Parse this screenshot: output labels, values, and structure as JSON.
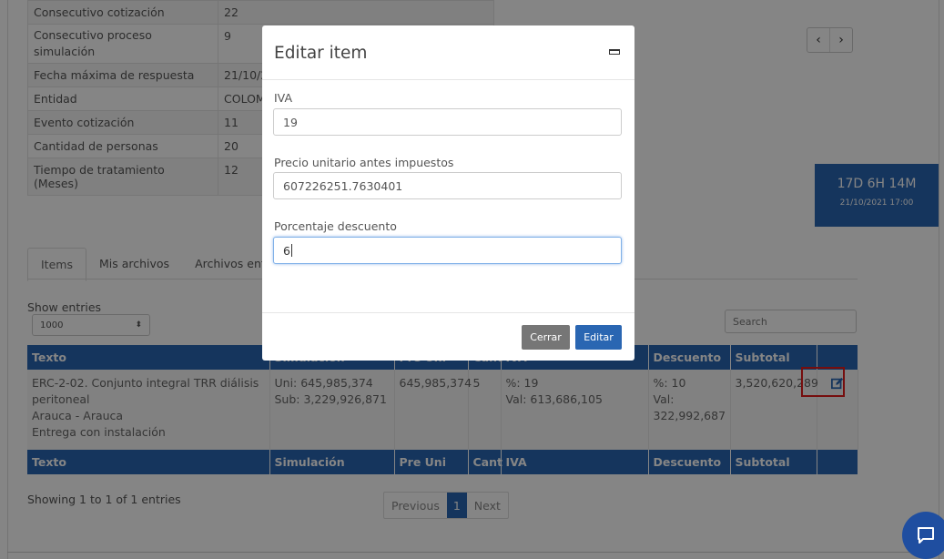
{
  "info_rows": [
    {
      "label": "Consecutivo cotización",
      "value": "22"
    },
    {
      "label": "Consecutivo proceso simulación",
      "value": "9"
    },
    {
      "label": "Fecha máxima de respuesta",
      "value": "21/10/2"
    },
    {
      "label": "Entidad",
      "value": "COLOM"
    },
    {
      "label": "Evento cotización",
      "value": "11"
    },
    {
      "label": "Cantidad de personas",
      "value": "20"
    },
    {
      "label": "Tiempo de tratamiento (Meses)",
      "value": "12"
    }
  ],
  "pager_arrows": {
    "prev": "‹",
    "next": "›"
  },
  "timer": {
    "remaining": "17D 6H 14M",
    "deadline": "21/10/2021 17:00",
    "color": "#2a66b2"
  },
  "tabs": [
    {
      "label": "Items"
    },
    {
      "label": "Mis archivos"
    },
    {
      "label": "Archivos ent"
    }
  ],
  "table_controls": {
    "show_entries": "Show entries",
    "entries_value": "1000",
    "search_placeholder": "Search"
  },
  "table": {
    "headers": [
      "Texto",
      "Simulación",
      "Pre Uni",
      "Cant",
      "IVA",
      "Descuento",
      "Subtotal",
      ""
    ],
    "row": {
      "texto": [
        "ERC-2-02. Conjunto integral TRR diálisis peritoneal",
        "Arauca - Arauca",
        "Entrega con instalación"
      ],
      "simulacion": [
        "Uni: 645,985,374",
        "Sub: 3,229,926,871"
      ],
      "pre_uni": "645,985,374",
      "cant": "5",
      "iva": [
        "%: 19",
        "Val: 613,686,105"
      ],
      "descuento": [
        "%: 10",
        "Val:",
        "322,992,687"
      ],
      "subtotal": "3,520,620,289"
    }
  },
  "footer": {
    "showing": "Showing 1 to 1 of 1 entries",
    "previous": "Previous",
    "page": "1",
    "next": "Next"
  },
  "modal": {
    "title": "Editar item",
    "fields": [
      {
        "label": "IVA",
        "value": "19"
      },
      {
        "label": "Precio unitario antes impuestos",
        "value": "607226251.7630401"
      },
      {
        "label": "Porcentaje descuento",
        "value": "6"
      }
    ],
    "close_label": "Cerrar",
    "edit_label": "Editar"
  },
  "icons": {
    "edit": "edit-icon",
    "chat": "chat-icon",
    "minimize": "minimize-icon"
  }
}
